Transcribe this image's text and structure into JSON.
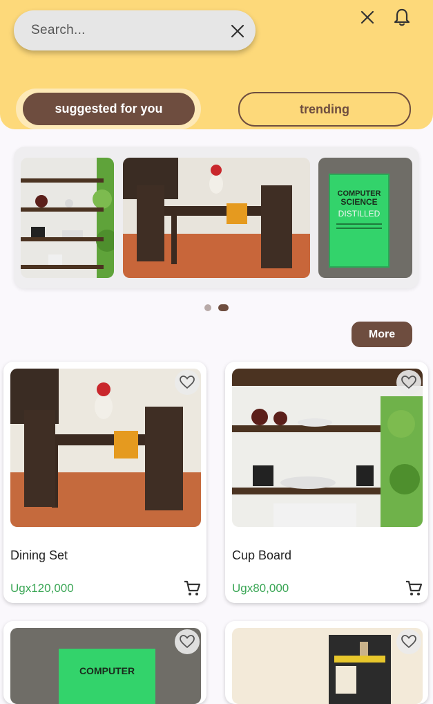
{
  "search": {
    "placeholder": "Search...",
    "clear_icon": "close-icon"
  },
  "header": {
    "icons": [
      "close-icon",
      "bell-icon"
    ]
  },
  "tabs": [
    {
      "label": "suggested for you",
      "active": true
    },
    {
      "label": "trending",
      "active": false
    }
  ],
  "carousel": {
    "slides": [
      "cupboard-image",
      "dining-set-image",
      "book-image"
    ],
    "dots": 2,
    "active_dot": 2,
    "book_cover": {
      "title_line1": "COMPUTER",
      "title_line2": "SCIENCE",
      "title_line3": "DISTILLED"
    }
  },
  "more_label": "More",
  "products": [
    {
      "name": "Dining Set",
      "price": "Ugx120,000",
      "image": "dining-set-image"
    },
    {
      "name": "Cup Board",
      "price": "Ugx80,000",
      "image": "cupboard-image"
    },
    {
      "name": "",
      "price": "",
      "image": "book-image",
      "cover_text": "COMPUTER"
    },
    {
      "name": "",
      "price": "",
      "image": "shelf-image"
    }
  ],
  "colors": {
    "header_bg": "#fdd97a",
    "brand": "#6e4d3f",
    "price": "#3aa655"
  }
}
